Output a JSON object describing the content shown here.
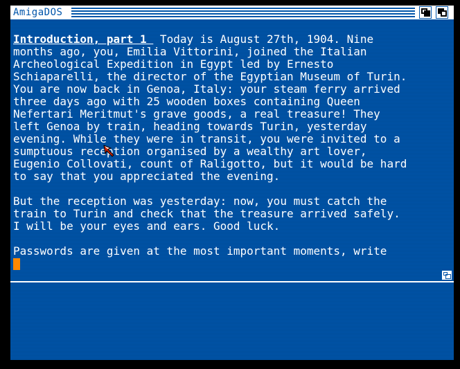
{
  "window": {
    "title": "AmigaDOS"
  },
  "console": {
    "heading": "Introduction, part 1 ",
    "lines": [
      " Today is August 27th, 1904. Nine",
      "months ago, you, Emilia Vittorini, joined the Italian",
      "Archeological Expedition in Egypt led by Ernesto",
      "Schiaparelli, the director of the Egyptian Museum of Turin.",
      "You are now back in Genoa, Italy: your steam ferry arrived",
      "three days ago with 25 wooden boxes containing Queen",
      "Nefertari Meritmut's grave goods, a real treasure! They",
      "left Genoa by train, heading towards Turin, yesterday",
      "evening. While they were in transit, you were invited to a",
      "sumptuous reception organised by a wealthy art lover,",
      "Eugenio Collovati, count of Raligotto, but it would be hard",
      "to say that you appreciated the evening.",
      "",
      "But the reception was yesterday: now, you must catch the",
      "train to Turin and check that the treasure arrived safely.",
      "I will be your eyes and ears. Good luck.",
      "",
      "Passwords are given at the most important moments, write"
    ]
  },
  "colors": {
    "background": "#0055aa",
    "text": "#ffffff",
    "cursor": "#ff8800",
    "pointer": "#cc2200"
  },
  "icons": {
    "depth_back": "depth-back-icon",
    "depth_front": "depth-front-icon",
    "size": "resize-icon",
    "pointer": "mouse-pointer-icon"
  }
}
